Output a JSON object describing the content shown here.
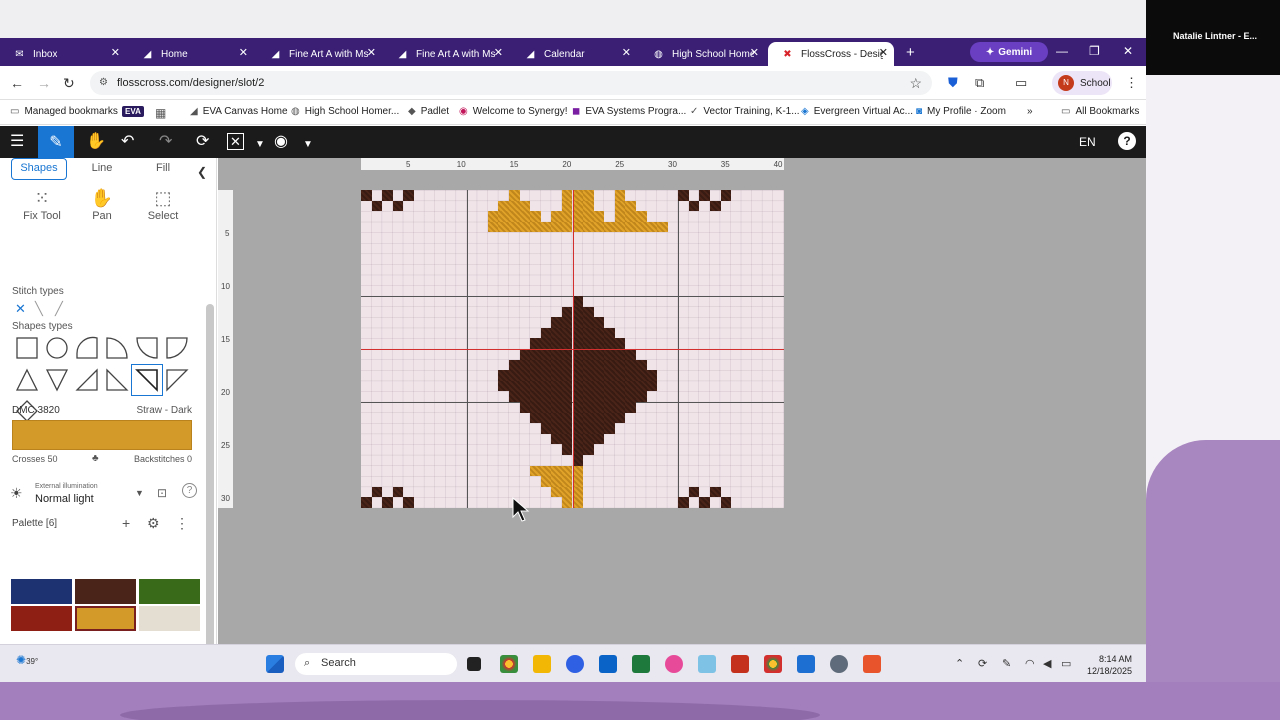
{
  "meeting": {
    "participant": "Natalie Lintner - E..."
  },
  "tabs": [
    {
      "label": "Inbox",
      "icon": "mail-icon"
    },
    {
      "label": "Home",
      "icon": "canvas-icon"
    },
    {
      "label": "Fine Art A with Ms",
      "icon": "canvas-icon"
    },
    {
      "label": "Fine Art A with Ms",
      "icon": "canvas-icon"
    },
    {
      "label": "Calendar",
      "icon": "canvas-icon"
    },
    {
      "label": "High School Home",
      "icon": "globe-icon"
    },
    {
      "label": "FlossCross - Desig",
      "icon": "flosscross-icon"
    }
  ],
  "gemini_label": "Gemini",
  "url": "flosscross.com/designer/slot/2",
  "profile_label": "School",
  "profile_initial": "N",
  "bookmarks": {
    "managed": "Managed bookmarks",
    "eva": "EVA",
    "items": [
      "EVA Canvas Home",
      "High School Homer...",
      "Padlet",
      "Welcome to Synergy!",
      "EVA Systems Progra...",
      "Vector Training, K-1...",
      "Evergreen Virtual Ac...",
      "My Profile · Zoom"
    ],
    "more": "»",
    "all": "All Bookmarks"
  },
  "toolbar": {
    "lang": "EN",
    "help": "?"
  },
  "sidebar": {
    "tabs": {
      "shapes": "Shapes",
      "line": "Line",
      "fill": "Fill"
    },
    "tools": {
      "fix": "Fix Tool",
      "pan": "Pan",
      "select": "Select"
    },
    "stitch_types_label": "Stitch types",
    "shape_types_label": "Shapes types",
    "color": {
      "code": "DMC 3820",
      "name": "Straw - Dark",
      "hex": "#d39a2a"
    },
    "crosses": "Crosses 50",
    "backstitches": "Backstitches 0",
    "illumination": {
      "label": "External illumination",
      "value": "Normal light"
    },
    "palette_label": "Palette [6]",
    "palette": [
      "#1d3270",
      "#4a2418",
      "#386a1a",
      "#8e1f14",
      "#d39a2a",
      "#e4ddd2"
    ]
  },
  "canvas": {
    "ruler_x": [
      "5",
      "10",
      "15",
      "20",
      "25",
      "30",
      "35",
      "40"
    ],
    "ruler_y": [
      "5",
      "10",
      "15",
      "20",
      "25",
      "30"
    ],
    "thread_colors": {
      "dark": "#4a2418",
      "gold": "#e0a228"
    }
  },
  "taskbar": {
    "weather": "39°",
    "search": "Search",
    "time": "8:14 AM",
    "date": "12/18/2025"
  }
}
